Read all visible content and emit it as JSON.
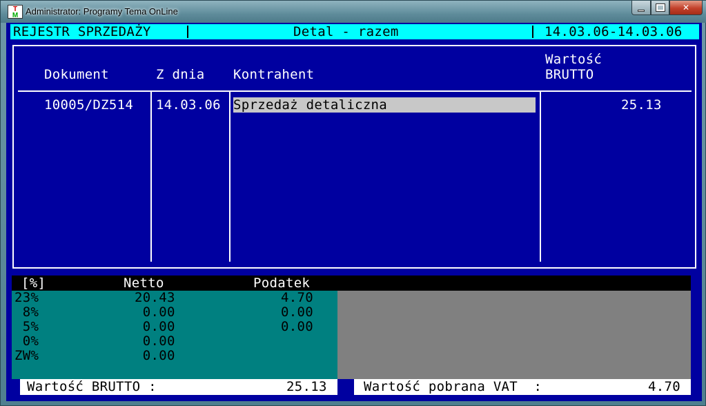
{
  "window": {
    "title": "Administrator:  Programy Tema OnLine",
    "icon_name": "tema-app-icon",
    "controls": {
      "minimize": "minimize",
      "maximize": "maximize",
      "close": "close"
    }
  },
  "header": {
    "left": "REJESTR SPRZEDAŻY",
    "center": "Detal - razem",
    "right": "14.03.06-14.03.06"
  },
  "table": {
    "columns": {
      "dokument": "Dokument",
      "z_dnia": "Z dnia",
      "kontrahent": "Kontrahent",
      "wartosc_line1": "Wartość",
      "wartosc_line2": "BRUTTO"
    },
    "rows": [
      {
        "dokument": "10005/DZ514",
        "z_dnia": "14.03.06",
        "kontrahent": "Sprzedaż detaliczna",
        "wartosc": "25.13"
      }
    ]
  },
  "vat": {
    "headers": {
      "rate": "[%]",
      "netto": "Netto",
      "podatek": "Podatek"
    },
    "rows": [
      {
        "rate": "23%",
        "netto": "20.43",
        "podatek": "4.70"
      },
      {
        "rate": " 8%",
        "netto": " 0.00",
        "podatek": "0.00"
      },
      {
        "rate": " 5%",
        "netto": " 0.00",
        "podatek": "0.00"
      },
      {
        "rate": " 0%",
        "netto": " 0.00",
        "podatek": ""
      },
      {
        "rate": "ZW%",
        "netto": " 0.00",
        "podatek": ""
      }
    ]
  },
  "totals": {
    "brutto_label": "Wartość BRUTTO :",
    "brutto_value": "25.13",
    "vat_label": "Wartość pobrana VAT  :",
    "vat_value": "4.70"
  },
  "colors": {
    "console_bg": "#0000a0",
    "header_bar": "#00ffff",
    "vat_table_bg": "#008080",
    "selection": "#c8c8c8"
  }
}
